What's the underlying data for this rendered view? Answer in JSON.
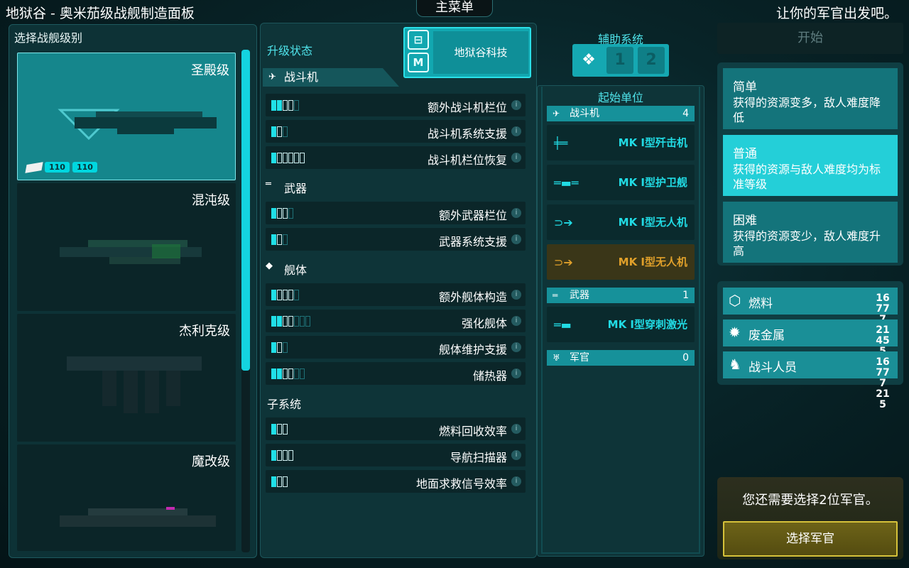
{
  "header": {
    "title": "地狱谷 - 奥米茄级战舰制造面板",
    "main_menu": "主菜单",
    "officer_prompt": "让你的军官出发吧。"
  },
  "ship_panel": {
    "title": "选择战舰级别",
    "ships": [
      {
        "name": "圣殿级",
        "selected": true,
        "badges": [
          "110",
          "110"
        ]
      },
      {
        "name": "混沌级",
        "selected": false
      },
      {
        "name": "杰利克级",
        "selected": false
      },
      {
        "name": "魔改级",
        "selected": false
      }
    ]
  },
  "upgrade": {
    "title": "升级状态",
    "tech_name": "地狱谷科技",
    "sections": {
      "fighters": "战斗机",
      "weapons": "武器",
      "hull": "舰体",
      "subsystems": "子系统"
    },
    "rows": [
      {
        "label": "额外战斗机栏位",
        "on": 2,
        "mid": 2,
        "off": 1
      },
      {
        "label": "战斗机系统支援",
        "on": 1,
        "mid": 1,
        "off": 1
      },
      {
        "label": "战斗机栏位恢复",
        "on": 1,
        "mid": 5,
        "off": 0
      },
      {
        "label": "额外武器栏位",
        "on": 1,
        "mid": 2,
        "off": 1
      },
      {
        "label": "武器系统支援",
        "on": 1,
        "mid": 1,
        "off": 1
      },
      {
        "label": "额外舰体构造",
        "on": 1,
        "mid": 3,
        "off": 1
      },
      {
        "label": "强化舰体",
        "on": 2,
        "mid": 2,
        "off": 3
      },
      {
        "label": "舰体维护支援",
        "on": 1,
        "mid": 1,
        "off": 1
      },
      {
        "label": "储热器",
        "on": 2,
        "mid": 2,
        "off": 2
      },
      {
        "label": "燃料回收效率",
        "on": 1,
        "mid": 2,
        "off": 0
      },
      {
        "label": "导航扫描器",
        "on": 1,
        "mid": 3,
        "off": 0
      },
      {
        "label": "地面求救信号效率",
        "on": 1,
        "mid": 2,
        "off": 0
      }
    ]
  },
  "aux": {
    "title": "辅助系统",
    "slots": [
      "1",
      "2"
    ]
  },
  "units": {
    "title": "起始单位",
    "fighters_header": "战斗机",
    "fighters_count": "4",
    "fighters": [
      {
        "name": "MK I型歼击机",
        "warn": false
      },
      {
        "name": "MK I型护卫舰",
        "warn": false
      },
      {
        "name": "MK I型无人机",
        "warn": false
      },
      {
        "name": "MK I型无人机",
        "warn": true
      }
    ],
    "weapons_header": "武器",
    "weapons_count": "1",
    "weapons": [
      {
        "name": "MK I型穿刺激光"
      }
    ],
    "officers_header": "军官",
    "officers_count": "0"
  },
  "right": {
    "start": "开始",
    "difficulties": [
      {
        "name": "简单",
        "desc": "获得的资源变多，敌人难度降低",
        "selected": false
      },
      {
        "name": "普通",
        "desc": "获得的资源与敌人难度均为标准等级",
        "selected": true
      },
      {
        "name": "困难",
        "desc": "获得的资源变少，敌人难度升高",
        "selected": false
      }
    ],
    "resources": [
      {
        "name": "燃料",
        "icon": "fuel-icon",
        "value": "16\n77\n7"
      },
      {
        "name": "废金属",
        "icon": "scrap-gear-icon",
        "value": "21\n45\n5"
      },
      {
        "name": "战斗人员",
        "icon": "soldier-icon",
        "value": "16\n77\n7\n21\n5"
      }
    ],
    "officer_need": "您还需要选择2位军官。",
    "select_officer": "选择军官"
  },
  "colors": {
    "accent_cyan": "#20e0e8",
    "warn_orange": "#e0a02a",
    "officer_gold": "#d6c23a"
  }
}
